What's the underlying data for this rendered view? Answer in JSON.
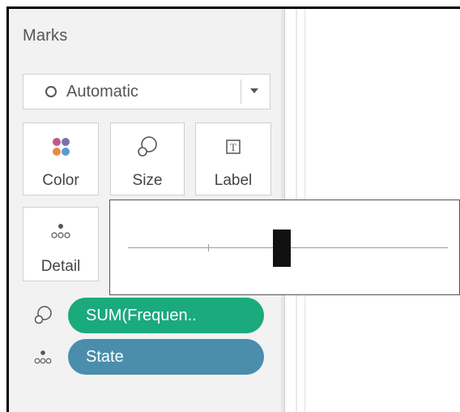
{
  "marks_card": {
    "title": "Marks",
    "mark_type": {
      "selected": "Automatic",
      "icon": "circle-icon"
    },
    "tiles": [
      {
        "label": "Color",
        "icon": "color-dots-icon"
      },
      {
        "label": "Size",
        "icon": "size-lasso-icon"
      },
      {
        "label": "Label",
        "icon": "text-label-icon"
      },
      {
        "label": "Detail",
        "icon": "detail-dots-icon"
      }
    ],
    "size_popup": {
      "slider_fraction": 0.48
    },
    "pills": [
      {
        "text": "SUM(Frequen..",
        "icon": "size-lasso-icon",
        "color": "#1aaa7c"
      },
      {
        "text": "State",
        "icon": "detail-dots-icon",
        "color": "#4a8eab"
      }
    ]
  }
}
